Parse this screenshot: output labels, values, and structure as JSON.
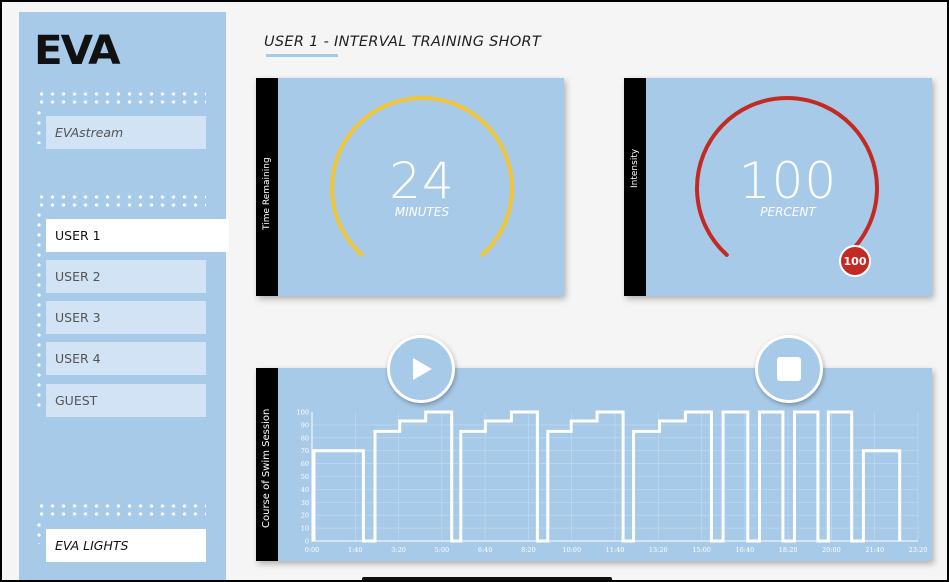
{
  "brand": {
    "logo": "EVA"
  },
  "sidebar": {
    "stream_item": "EVAstream",
    "users": [
      {
        "label": "USER 1",
        "active": true
      },
      {
        "label": "USER 2",
        "active": false
      },
      {
        "label": "USER 3",
        "active": false
      },
      {
        "label": "USER 4",
        "active": false
      },
      {
        "label": "GUEST",
        "active": false
      }
    ],
    "lights_item": "EVA LIGHTS"
  },
  "page": {
    "title": "USER 1 - INTERVAL TRAINING SHORT"
  },
  "gauges": {
    "time": {
      "label": "Time Remaining",
      "value": "24",
      "unit": "MINUTES",
      "color": "#f0c53a"
    },
    "intensity": {
      "label": "Intensity",
      "value": "100",
      "unit": "PERCENT",
      "badge": "100",
      "color": "#c42a24"
    }
  },
  "controls": {
    "play_icon": "play-icon",
    "stop_icon": "stop-icon"
  },
  "chart_data": {
    "type": "line",
    "ylabel": "Course of Swim Session",
    "ylim": [
      0,
      100
    ],
    "yticks": [
      "0",
      "10",
      "20",
      "30",
      "40",
      "50",
      "60",
      "70",
      "80",
      "90",
      "100"
    ],
    "xticks": [
      "0:00",
      "1:40",
      "3:20",
      "5:00",
      "6:40",
      "8:20",
      "10:00",
      "11:40",
      "13:20",
      "15:00",
      "16:40",
      "18:20",
      "20:00",
      "21:40",
      "23:20"
    ],
    "step_points": [
      [
        0,
        0
      ],
      [
        0,
        70
      ],
      [
        1.9,
        70
      ],
      [
        1.9,
        0
      ],
      [
        2.35,
        0
      ],
      [
        2.35,
        85
      ],
      [
        3.3,
        85
      ],
      [
        3.3,
        93
      ],
      [
        4.3,
        93
      ],
      [
        4.3,
        100
      ],
      [
        5.3,
        100
      ],
      [
        5.3,
        0
      ],
      [
        5.65,
        0
      ],
      [
        5.65,
        85
      ],
      [
        6.6,
        85
      ],
      [
        6.6,
        93
      ],
      [
        7.6,
        93
      ],
      [
        7.6,
        100
      ],
      [
        8.6,
        100
      ],
      [
        8.6,
        0
      ],
      [
        9.0,
        0
      ],
      [
        9.0,
        85
      ],
      [
        9.9,
        85
      ],
      [
        9.9,
        93
      ],
      [
        10.9,
        93
      ],
      [
        10.9,
        100
      ],
      [
        11.9,
        100
      ],
      [
        11.9,
        0
      ],
      [
        12.3,
        0
      ],
      [
        12.3,
        85
      ],
      [
        13.3,
        85
      ],
      [
        13.3,
        93
      ],
      [
        14.3,
        93
      ],
      [
        14.3,
        100
      ],
      [
        15.3,
        100
      ],
      [
        15.3,
        0
      ],
      [
        15.75,
        0
      ],
      [
        15.75,
        100
      ],
      [
        16.7,
        100
      ],
      [
        16.7,
        0
      ],
      [
        17.15,
        0
      ],
      [
        17.15,
        100
      ],
      [
        18.05,
        100
      ],
      [
        18.05,
        0
      ],
      [
        18.5,
        0
      ],
      [
        18.5,
        100
      ],
      [
        19.4,
        100
      ],
      [
        19.4,
        0
      ],
      [
        19.8,
        0
      ],
      [
        19.8,
        100
      ],
      [
        20.7,
        100
      ],
      [
        20.7,
        0
      ],
      [
        21.15,
        0
      ],
      [
        21.15,
        70
      ],
      [
        22.55,
        70
      ],
      [
        22.55,
        0
      ]
    ],
    "grid": true,
    "line_color": "#ffffff"
  }
}
